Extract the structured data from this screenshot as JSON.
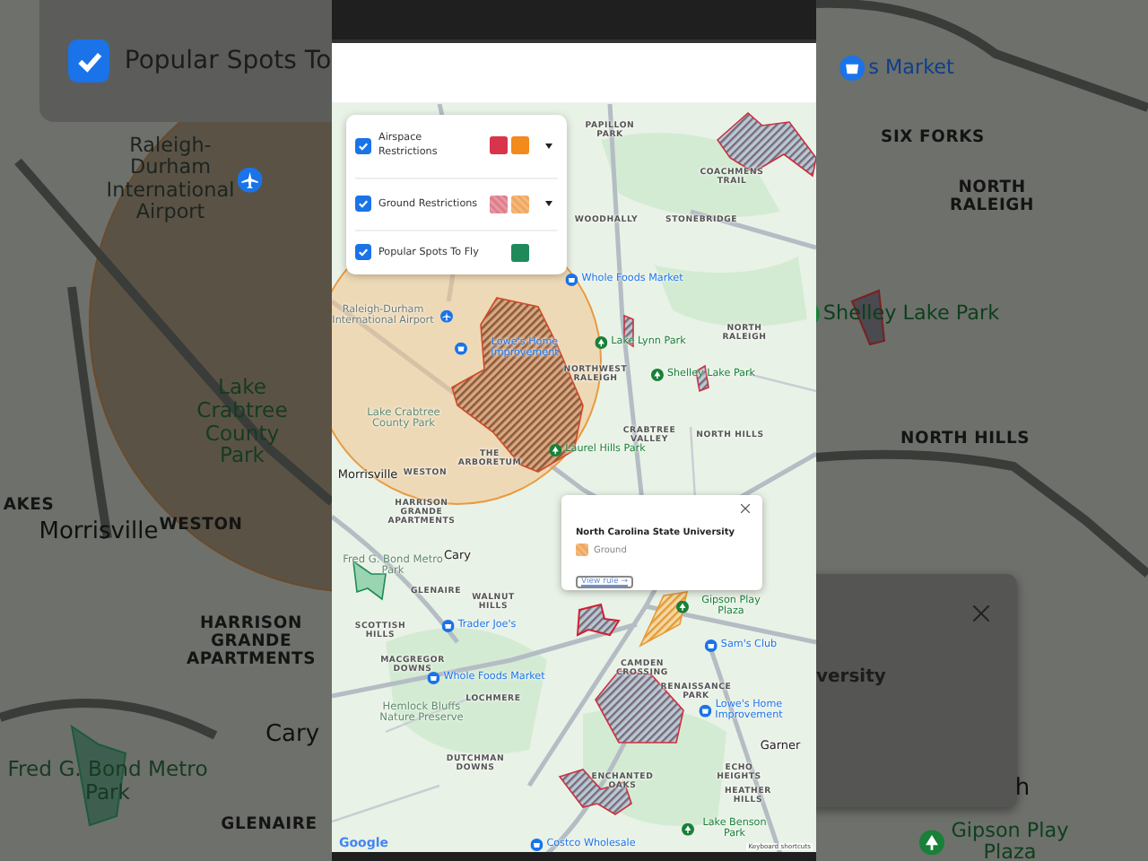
{
  "backdrop_left": {
    "layer_card": {
      "label": "Popular Spots To",
      "checked": true
    },
    "labels": [
      {
        "text": "Raleigh-Durham International Airport",
        "kind": "airport"
      },
      {
        "text": "Lake Crabtree County Park",
        "kind": "place"
      },
      {
        "text": "AKES",
        "kind": "district"
      },
      {
        "text": "Morrisville",
        "kind": "city"
      },
      {
        "text": "WESTON",
        "kind": "district"
      },
      {
        "text": "HARRISON GRANDE APARTMENTS",
        "kind": "district"
      },
      {
        "text": "Cary",
        "kind": "city"
      },
      {
        "text": "Fred G. Bond Metro Park",
        "kind": "place"
      },
      {
        "text": "GLENAIRE",
        "kind": "district"
      }
    ]
  },
  "phone": {
    "legend": {
      "layers": [
        {
          "label": "Airspace Restrictions",
          "checked": true,
          "dropdown": true,
          "swatches": [
            {
              "color": "#d8344b",
              "kind": "solid"
            },
            {
              "color": "#f28a1c",
              "kind": "solid"
            }
          ]
        },
        {
          "label": "Ground Restrictions",
          "checked": true,
          "dropdown": true,
          "swatches": [
            {
              "color": "#e07f8c",
              "kind": "hatched"
            },
            {
              "color": "#f0a860",
              "kind": "hatched"
            }
          ]
        },
        {
          "label": "Popular Spots To Fly",
          "checked": true,
          "dropdown": false,
          "swatches": [
            {
              "color": "#1e8a5a",
              "kind": "solid"
            }
          ]
        }
      ]
    },
    "map": {
      "labels": [
        {
          "text": "PAPILLON PARK",
          "kind": "district"
        },
        {
          "text": "COACHMENS TRAIL",
          "kind": "district"
        },
        {
          "text": "WOODHALLY",
          "kind": "district"
        },
        {
          "text": "STONEBRIDGE",
          "kind": "district"
        },
        {
          "text": "Whole Foods Market",
          "kind": "poi"
        },
        {
          "text": "Raleigh-Durham International Airport",
          "kind": "airport"
        },
        {
          "text": "Lowe's Home Improvement",
          "kind": "poi"
        },
        {
          "text": "Lake Lynn Park",
          "kind": "park"
        },
        {
          "text": "NORTH RALEIGH",
          "kind": "district"
        },
        {
          "text": "NORTHWEST RALEIGH",
          "kind": "district"
        },
        {
          "text": "Shelley Lake Park",
          "kind": "park"
        },
        {
          "text": "Lake Crabtree County Park",
          "kind": "place"
        },
        {
          "text": "CRABTREE VALLEY",
          "kind": "district"
        },
        {
          "text": "NORTH HILLS",
          "kind": "district"
        },
        {
          "text": "Laurel Hills Park",
          "kind": "park"
        },
        {
          "text": "THE ARBORETUM",
          "kind": "district"
        },
        {
          "text": "WESTON",
          "kind": "district"
        },
        {
          "text": "Morrisville",
          "kind": "city"
        },
        {
          "text": "HARRISON GRANDE APARTMENTS",
          "kind": "district"
        },
        {
          "text": "Cary",
          "kind": "city"
        },
        {
          "text": "Fred G. Bond Metro Park",
          "kind": "place"
        },
        {
          "text": "GLENAIRE",
          "kind": "district"
        },
        {
          "text": "WALNUT HILLS",
          "kind": "district"
        },
        {
          "text": "SCOTTISH HILLS",
          "kind": "district"
        },
        {
          "text": "Trader Joe's",
          "kind": "poi"
        },
        {
          "text": "Gipson Play Plaza",
          "kind": "park"
        },
        {
          "text": "Sam's Club",
          "kind": "poi"
        },
        {
          "text": "MACGREGOR DOWNS",
          "kind": "district"
        },
        {
          "text": "Whole Foods Market",
          "kind": "poi"
        },
        {
          "text": "CAMDEN CROSSING",
          "kind": "district"
        },
        {
          "text": "RENAISSANCE PARK",
          "kind": "district"
        },
        {
          "text": "LOCHMERE",
          "kind": "district"
        },
        {
          "text": "Hemlock Bluffs Nature Preserve",
          "kind": "place"
        },
        {
          "text": "Lowe's Home Improvement",
          "kind": "poi"
        },
        {
          "text": "DUTCHMAN DOWNS",
          "kind": "district"
        },
        {
          "text": "Garner",
          "kind": "city"
        },
        {
          "text": "ECHO HEIGHTS",
          "kind": "district"
        },
        {
          "text": "ENCHANTED OAKS",
          "kind": "district"
        },
        {
          "text": "HEATHER HILLS",
          "kind": "district"
        },
        {
          "text": "Lake Benson Park",
          "kind": "park"
        },
        {
          "text": "Costco Wholesale",
          "kind": "poi"
        }
      ],
      "popup": {
        "title": "North Carolina State University",
        "category": {
          "label": "Ground",
          "color": "#f0a860"
        },
        "link": "View rule →"
      },
      "attribution": {
        "logo": "Google",
        "shortcuts": "Keyboard shortcuts"
      }
    }
  },
  "backdrop_right": {
    "labels": [
      {
        "text": "s Market",
        "kind": "poi"
      },
      {
        "text": "SIX FORKS",
        "kind": "district"
      },
      {
        "text": "NORTH RALEIGH",
        "kind": "district"
      },
      {
        "text": "Shelley Lake Park",
        "kind": "park"
      },
      {
        "text": "NORTH HILLS",
        "kind": "district"
      },
      {
        "text": "h",
        "kind": "city"
      },
      {
        "text": "Gipson Play Plaza",
        "kind": "park"
      }
    ],
    "popup_fragment": {
      "title": "versity"
    }
  }
}
